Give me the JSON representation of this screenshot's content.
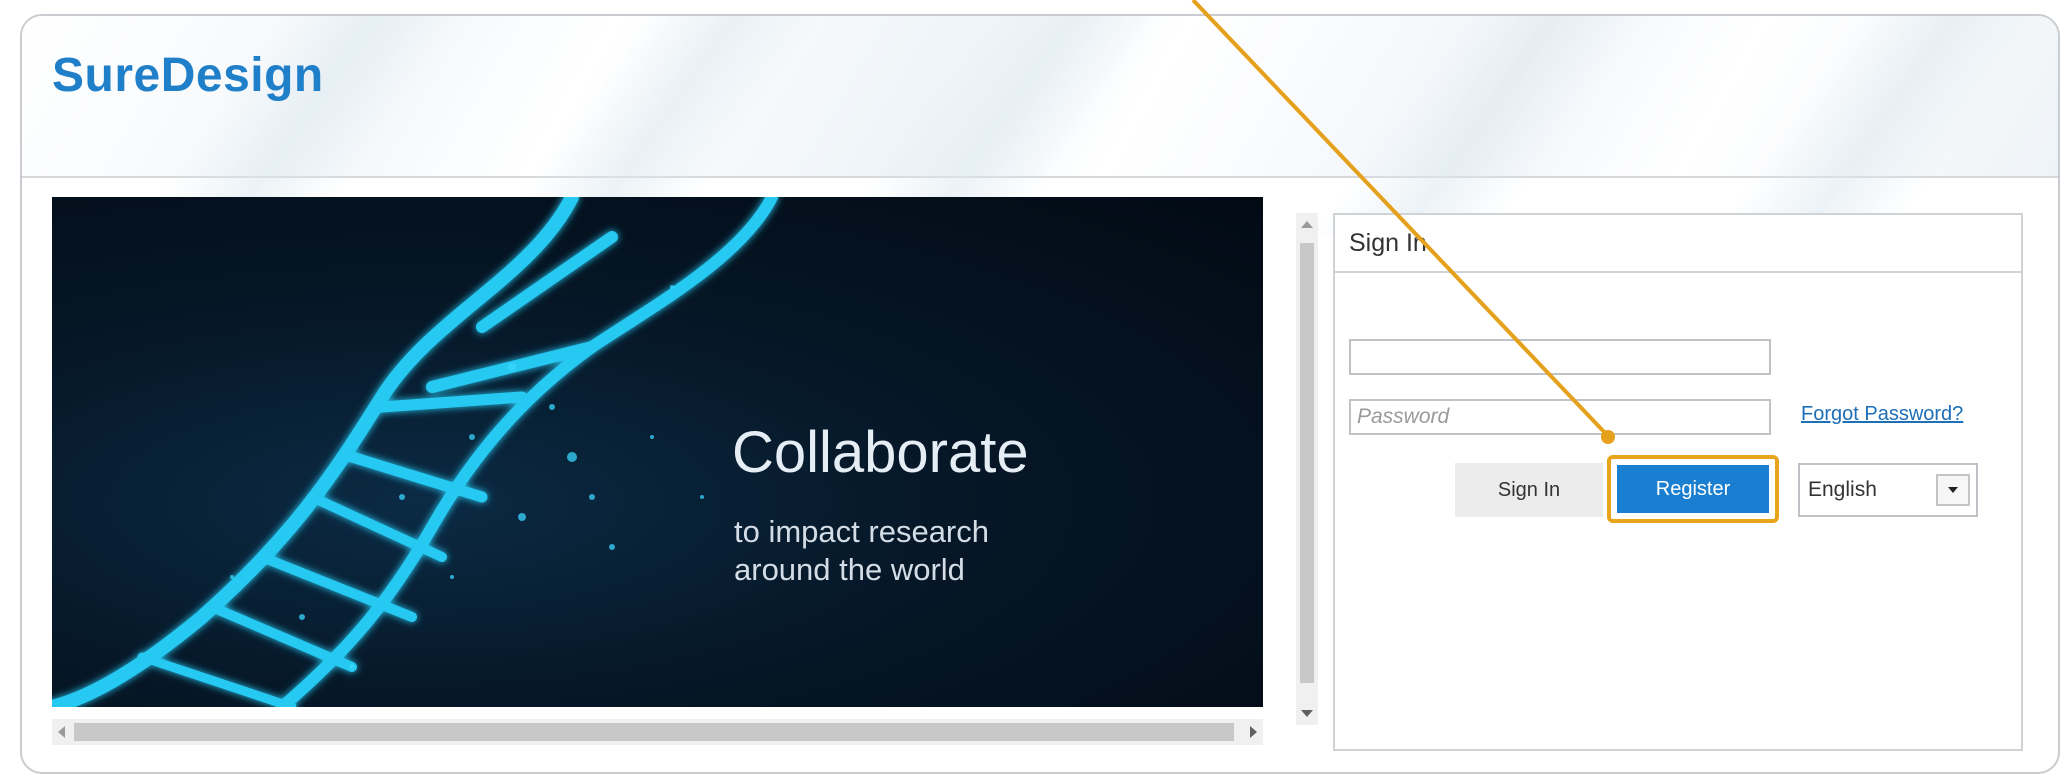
{
  "app": {
    "brand": "SureDesign"
  },
  "hero": {
    "title": "Collaborate",
    "subtitle_line1": "to impact research",
    "subtitle_line2": "around the world"
  },
  "signin": {
    "header": "Sign In",
    "username_value": "",
    "password_placeholder": "Password",
    "forgot_label": "Forgot Password?",
    "signin_button": "Sign In",
    "register_button": "Register",
    "language_selected": "English"
  },
  "icons": {
    "language_dropdown": "chevron-down-icon",
    "hscroll_left": "arrow-left-icon",
    "hscroll_right": "arrow-right-icon",
    "vscroll_up": "arrow-up-icon",
    "vscroll_down": "arrow-down-icon"
  },
  "colors": {
    "brand": "#1f7fc8",
    "register_bg": "#1a7fd0",
    "highlight": "#e8a51c",
    "link": "#1d6fb8"
  }
}
